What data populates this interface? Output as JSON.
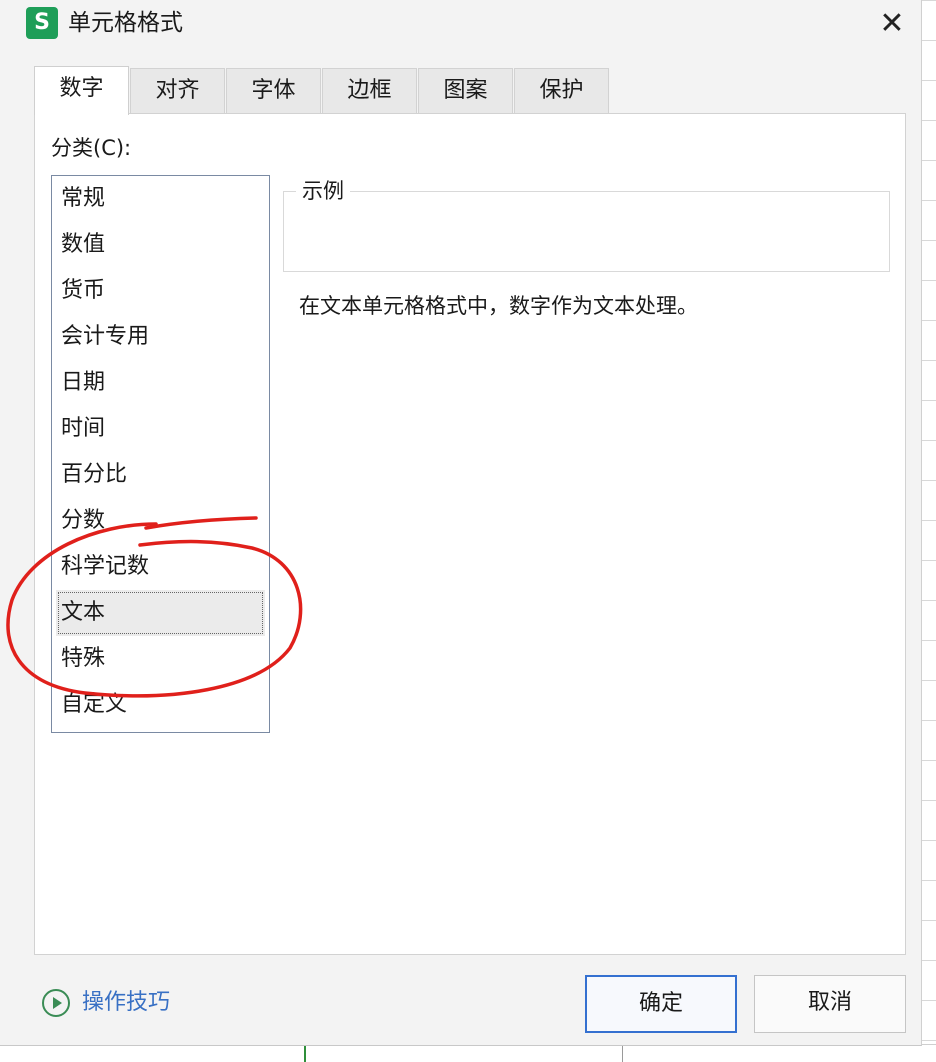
{
  "window": {
    "app_icon_letter": "S",
    "title": "单元格格式",
    "close_glyph": "✕"
  },
  "tabs": [
    {
      "label": "数字",
      "active": true
    },
    {
      "label": "对齐",
      "active": false
    },
    {
      "label": "字体",
      "active": false
    },
    {
      "label": "边框",
      "active": false
    },
    {
      "label": "图案",
      "active": false
    },
    {
      "label": "保护",
      "active": false
    }
  ],
  "category": {
    "label": "分类(C):",
    "items": [
      "常规",
      "数值",
      "货币",
      "会计专用",
      "日期",
      "时间",
      "百分比",
      "分数",
      "科学记数",
      "文本",
      "特殊",
      "自定义"
    ],
    "selected": "文本"
  },
  "sample": {
    "legend": "示例"
  },
  "description": "在文本单元格格式中，数字作为文本处理。",
  "footer": {
    "tips_label": "操作技巧",
    "ok_label": "确定",
    "cancel_label": "取消"
  },
  "colors": {
    "brand": "#1e9e58",
    "accent": "#3470d0",
    "link": "#3870c4",
    "annotation": "#e0201b"
  },
  "icons": {
    "app": "wps-spreadsheet-icon",
    "close": "close-icon",
    "tips": "play-circle-icon"
  }
}
